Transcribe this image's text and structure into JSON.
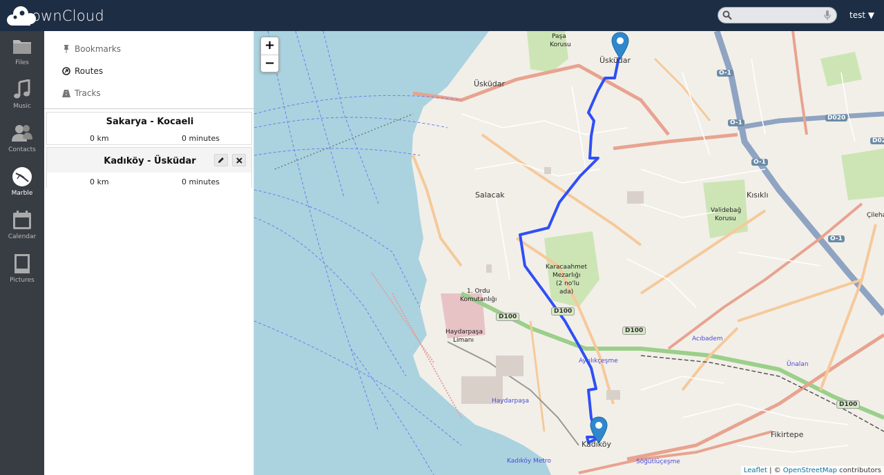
{
  "header": {
    "brand": "ownCloud",
    "search": {
      "placeholder": "",
      "value": ""
    },
    "user": "test ▼"
  },
  "nav": {
    "items": [
      {
        "label": "Files",
        "icon": "folder-icon"
      },
      {
        "label": "Music",
        "icon": "music-icon"
      },
      {
        "label": "Contacts",
        "icon": "contacts-icon"
      },
      {
        "label": "Marble",
        "icon": "marble-icon"
      },
      {
        "label": "Calendar",
        "icon": "calendar-icon"
      },
      {
        "label": "Pictures",
        "icon": "pictures-icon"
      }
    ],
    "active": "Marble"
  },
  "sidebar": {
    "tabs": [
      {
        "label": "Bookmarks",
        "icon": "pin-icon"
      },
      {
        "label": "Routes",
        "icon": "route-icon"
      },
      {
        "label": "Tracks",
        "icon": "road-icon"
      }
    ],
    "active_tab": "Routes",
    "routes": [
      {
        "title": "Sakarya - Kocaeli",
        "distance": "0 km",
        "duration": "0 minutes"
      },
      {
        "title": "Kadıköy - Üsküdar",
        "distance": "0 km",
        "duration": "0 minutes"
      }
    ]
  },
  "map": {
    "zoom_in": "+",
    "zoom_out": "−",
    "attribution": {
      "leaflet": "Leaflet",
      "sep": " | © ",
      "osm": "OpenStreetMap",
      "suffix": " contributors"
    },
    "labels": {
      "pasa_korusu_1": "Paşa",
      "pasa_korusu_2": "Korusu",
      "uskudar_1": "Üsküdar",
      "uskudar_2": "Üsküdar",
      "salacak": "Salacak",
      "kisikli": "Kısıklı",
      "validebag_1": "Validebağ",
      "validebag_2": "Korusu",
      "karacaahmet_1": "Karacaahmet",
      "karacaahmet_2": "Mezarlığı",
      "karacaahmet_3": "(2 no'lu",
      "karacaahmet_4": "ada)",
      "ordu_1": "1. Ordu",
      "ordu_2": "Komutanlığı",
      "haydarpasa_limani_1": "Haydarpaşa",
      "haydarpasa_limani_2": "Limanı",
      "kadikoy": "Kadıköy",
      "fikirtepe": "Fikirtepe",
      "acibadem": "Acıbadem",
      "ayrilikcesme": "Ayrılıkçeşme",
      "haydarpasa_station": "Haydarpaşa",
      "kadikoy_metro": "Kadıköy Metro",
      "unalan": "Ünalan",
      "sogutlucesme": "Söğütlüçeşme",
      "cilehane": "Çilehan"
    },
    "shields": [
      "O-1",
      "O-1",
      "O-1",
      "O-1",
      "D020",
      "D02",
      "D100",
      "D100",
      "D100",
      "D100"
    ],
    "colors": {
      "water": "#aad3df",
      "land": "#f2efe9",
      "route": "#2f4ff5",
      "marker": "#2f88cc"
    }
  }
}
